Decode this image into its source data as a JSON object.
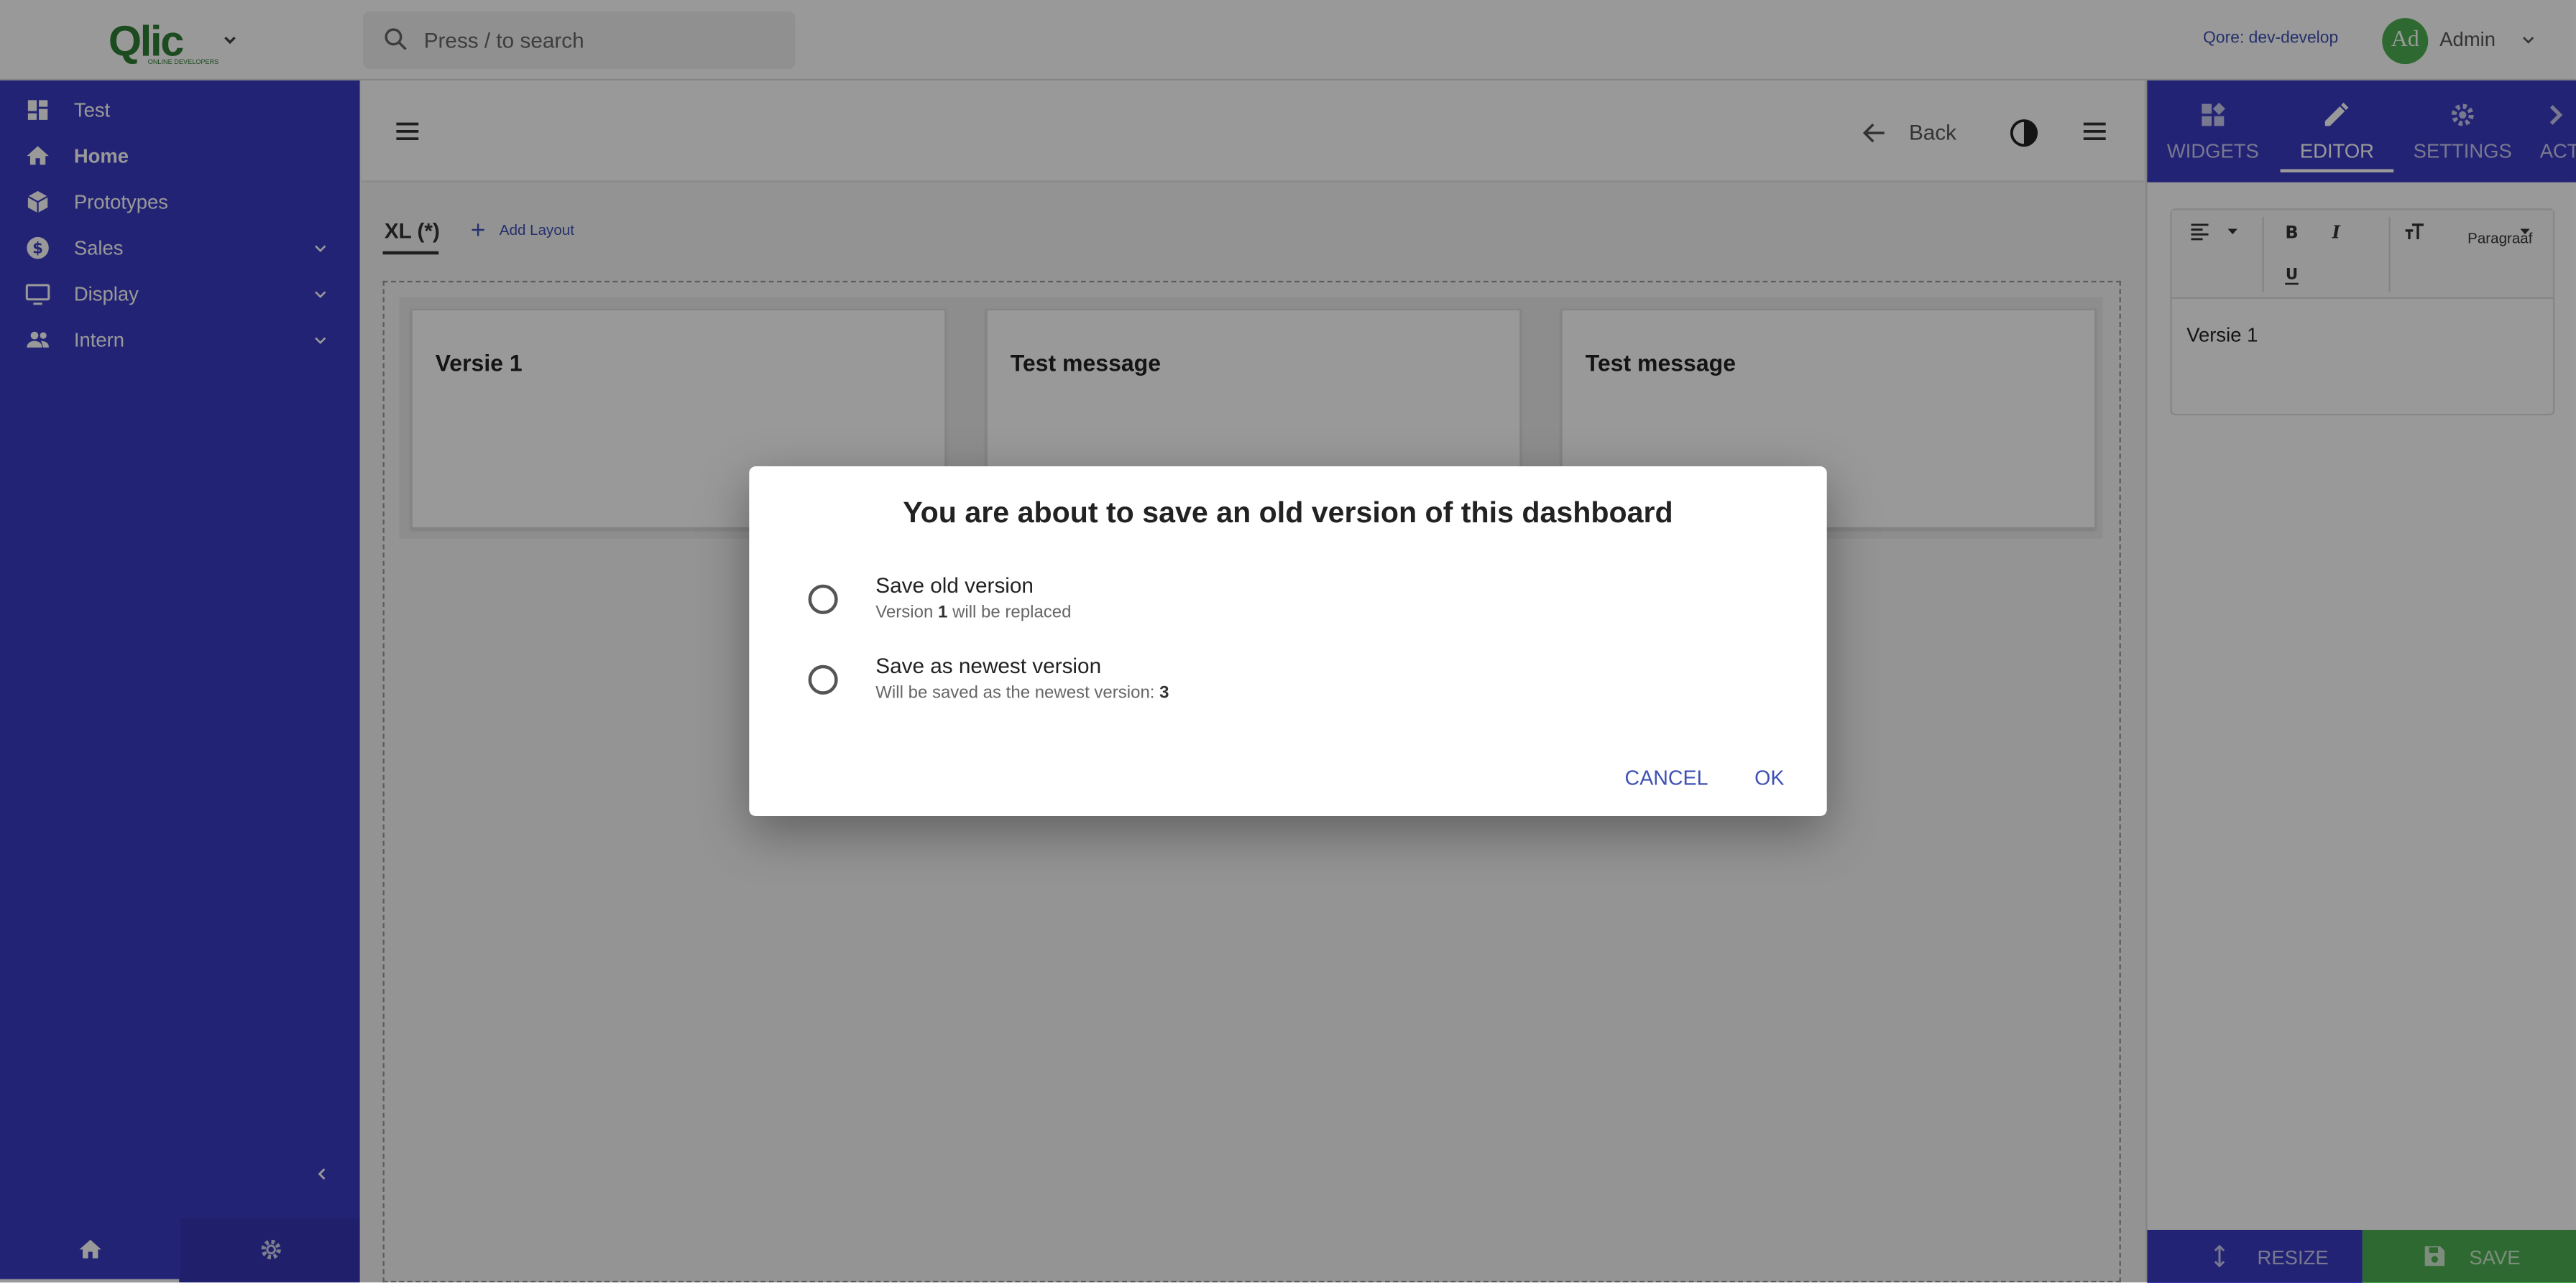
{
  "header": {
    "logo_text": "Qlic",
    "logo_subtitle": "ONLINE DEVELOPERS",
    "search_placeholder": "Press / to search",
    "environment": "Qore: dev-develop",
    "avatar_initials": "Ad",
    "user_name": "Admin"
  },
  "sidebar": {
    "items": [
      {
        "label": "Test",
        "icon": "dashboard-icon"
      },
      {
        "label": "Home",
        "icon": "home-icon"
      },
      {
        "label": "Prototypes",
        "icon": "cube-icon"
      },
      {
        "label": "Sales",
        "icon": "dollar-icon"
      },
      {
        "label": "Display",
        "icon": "monitor-icon"
      },
      {
        "label": "Intern",
        "icon": "people-icon"
      }
    ]
  },
  "main": {
    "back_label": "Back",
    "layout_tab": "XL (*)",
    "add_layout_label": "Add Layout",
    "widgets": [
      "Versie 1",
      "Test message",
      "Test message"
    ]
  },
  "right_panel": {
    "tabs": [
      "WIDGETS",
      "EDITOR",
      "SETTINGS",
      "ACT"
    ],
    "paragraph_label": "Paragraaf",
    "editor_text": "Versie 1",
    "resize_label": "RESIZE",
    "save_label": "SAVE"
  },
  "dialog": {
    "title": "You are about to save an old version of this dashboard",
    "option1_title": "Save old version",
    "option1_sub_prefix": "Version",
    "option1_version": "1",
    "option1_sub_suffix": "will be replaced",
    "option2_title": "Save as newest version",
    "option2_sub_prefix": "Will be saved as the newest version:",
    "option2_version": "3",
    "cancel_label": "CANCEL",
    "ok_label": "OK"
  },
  "colors": {
    "sidebar": "#3b3bc4",
    "accent": "#3f51b5",
    "save_green": "#4caf50"
  }
}
